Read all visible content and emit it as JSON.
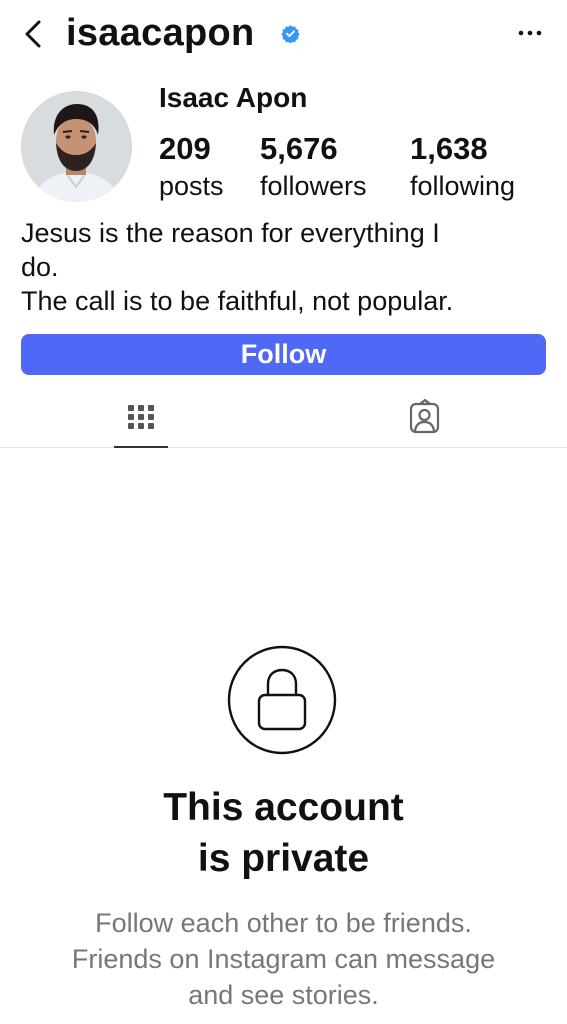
{
  "header": {
    "username": "isaacapon",
    "verified": true,
    "back_icon": "chevron-left-icon",
    "more_icon": "more-horizontal-icon",
    "accent_verified": "#3897f0"
  },
  "profile": {
    "full_name": "Isaac Apon",
    "stats": {
      "posts": {
        "value": "209",
        "label": "posts"
      },
      "followers": {
        "value": "5,676",
        "label": "followers"
      },
      "following": {
        "value": "1,638",
        "label": "following"
      }
    },
    "bio": [
      "Jesus is the reason for everything I",
      "do.",
      "The call is to be faithful, not popular."
    ]
  },
  "actions": {
    "follow_label": "Follow",
    "follow_color": "#4f68f6"
  },
  "tabs": [
    {
      "name": "grid",
      "icon": "grid-icon",
      "active": true
    },
    {
      "name": "tagged",
      "icon": "tagged-person-icon",
      "active": false
    }
  ],
  "private_notice": {
    "icon": "lock-icon",
    "title_lines": [
      "This account",
      "is private"
    ],
    "subtitle_lines": [
      "Follow each other to be friends.",
      "Friends on Instagram can message",
      "and see stories."
    ]
  }
}
